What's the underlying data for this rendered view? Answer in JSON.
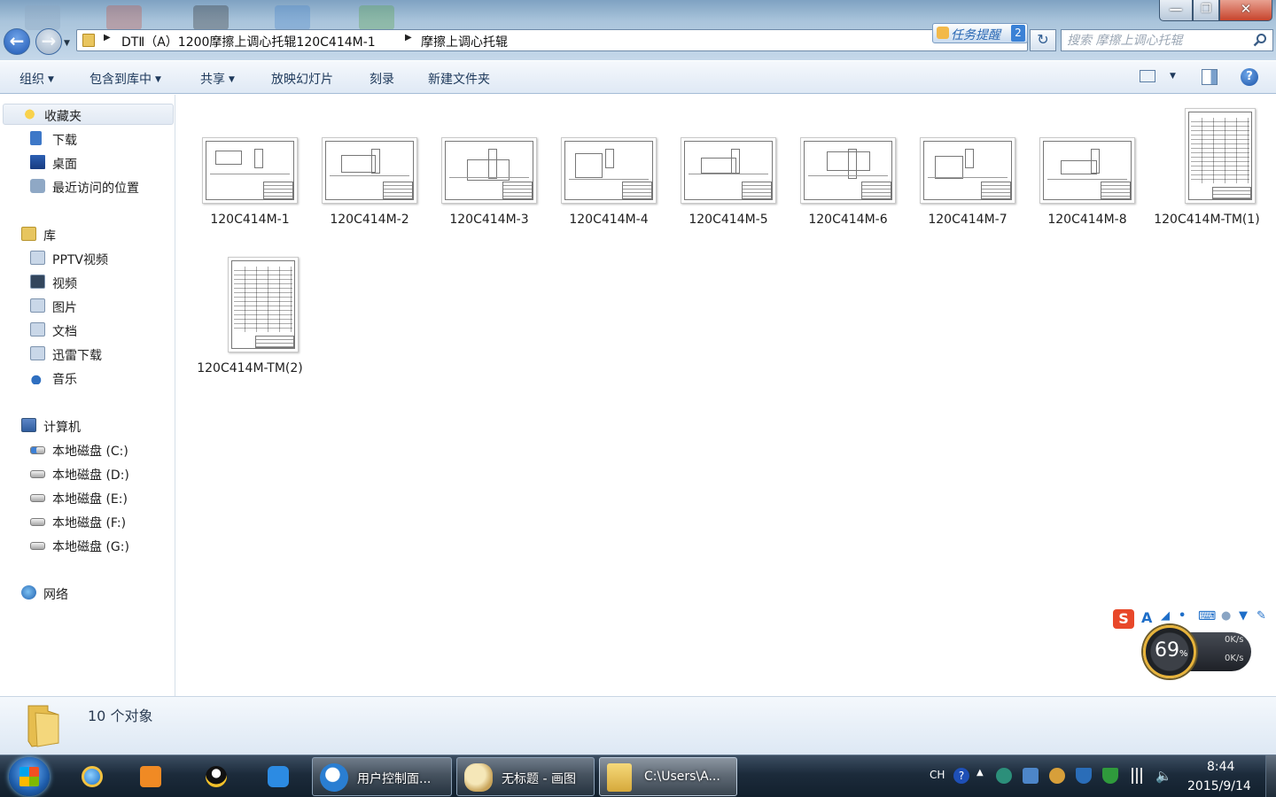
{
  "window": {
    "minimize_glyph": "—",
    "maximize_glyph": "❐",
    "close_glyph": "✕"
  },
  "address_bar": {
    "breadcrumbs": [
      "DTⅡ（A）1200摩擦上调心托辊120C414M-1",
      "摩擦上调心托辊"
    ],
    "task_reminder_label": "任务提醒",
    "task_reminder_count": "2"
  },
  "search": {
    "placeholder": "搜索 摩擦上调心托辊"
  },
  "toolbar": {
    "organize": "组织",
    "include_in_library": "包含到库中",
    "share": "共享",
    "slideshow": "放映幻灯片",
    "burn": "刻录",
    "new_folder": "新建文件夹",
    "help": "?"
  },
  "sidebar": {
    "favorites": {
      "label": "收藏夹",
      "items": [
        {
          "label": "下载",
          "icon": "download-folder-icon"
        },
        {
          "label": "桌面",
          "icon": "desktop-icon"
        },
        {
          "label": "最近访问的位置",
          "icon": "recent-places-icon"
        }
      ]
    },
    "libraries": {
      "label": "库",
      "items": [
        {
          "label": "PPTV视频",
          "icon": "library-icon"
        },
        {
          "label": "视频",
          "icon": "video-library-icon"
        },
        {
          "label": "图片",
          "icon": "pictures-library-icon"
        },
        {
          "label": "文档",
          "icon": "documents-library-icon"
        },
        {
          "label": "迅雷下载",
          "icon": "library-icon"
        },
        {
          "label": "音乐",
          "icon": "music-library-icon"
        }
      ]
    },
    "computer": {
      "label": "计算机",
      "items": [
        {
          "label": "本地磁盘 (C:)",
          "icon": "system-drive-icon"
        },
        {
          "label": "本地磁盘 (D:)",
          "icon": "drive-icon"
        },
        {
          "label": "本地磁盘 (E:)",
          "icon": "drive-icon"
        },
        {
          "label": "本地磁盘 (F:)",
          "icon": "drive-icon"
        },
        {
          "label": "本地磁盘 (G:)",
          "icon": "drive-icon"
        }
      ]
    },
    "network": {
      "label": "网络"
    }
  },
  "files": [
    {
      "name": "120C414M-1",
      "kind": "landscape-drawing"
    },
    {
      "name": "120C414M-2",
      "kind": "landscape-drawing"
    },
    {
      "name": "120C414M-3",
      "kind": "landscape-drawing"
    },
    {
      "name": "120C414M-4",
      "kind": "landscape-drawing"
    },
    {
      "name": "120C414M-5",
      "kind": "landscape-drawing"
    },
    {
      "name": "120C414M-6",
      "kind": "landscape-drawing"
    },
    {
      "name": "120C414M-7",
      "kind": "landscape-drawing"
    },
    {
      "name": "120C414M-8",
      "kind": "landscape-drawing"
    },
    {
      "name": "120C414M-TM(1)",
      "kind": "portrait-table"
    },
    {
      "name": "120C414M-TM(2)",
      "kind": "portrait-table"
    }
  ],
  "status": {
    "object_count": "10 个对象"
  },
  "floating": {
    "ime_letter": "A",
    "cpu_percent_value": "69",
    "percent_sign": "%",
    "upload_speed": "0K/s",
    "download_speed": "0K/s"
  },
  "taskbar": {
    "tasks": [
      {
        "label": "用户控制面...",
        "icon": "sogou-browser-icon"
      },
      {
        "label": "无标题 - 画图",
        "icon": "paint-icon"
      },
      {
        "label": "C:\\Users\\A...",
        "icon": "explorer-folder-icon"
      }
    ],
    "language": "CH",
    "time": "8:44",
    "date": "2015/9/14"
  }
}
